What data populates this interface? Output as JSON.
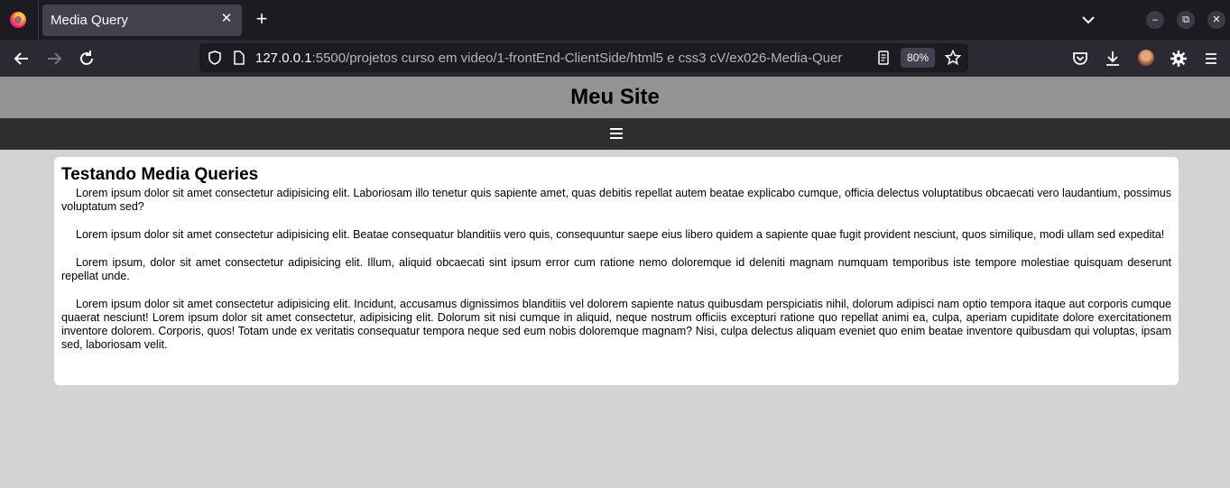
{
  "browser": {
    "tab_title": "Media Query",
    "tab_close": "✕",
    "new_tab": "+",
    "url_host": "127.0.0.1",
    "url_rest": ":5500/projetos curso em video/1-frontEnd-ClientSide/html5 e css3 cV/ex026-Media-Quer",
    "zoom": "80%",
    "window_controls": {
      "minimize": "–",
      "restore": "⧉",
      "close": "✕"
    },
    "icons": [
      "firefox-logo",
      "back-icon",
      "forward-icon",
      "reload-icon",
      "shield-icon",
      "page-icon",
      "reader-view-icon",
      "bookmark-star-icon",
      "pocket-icon",
      "download-icon",
      "avatar",
      "extension-gear-icon",
      "hamburger-menu-icon",
      "tab-list-chevron-icon"
    ]
  },
  "site": {
    "title": "Meu Site",
    "nav_icon": "hamburger-menu-icon",
    "article": {
      "heading": "Testando Media Queries",
      "paragraphs": [
        "Lorem ipsum dolor sit amet consectetur adipisicing elit. Laboriosam illo tenetur quis sapiente amet, quas debitis repellat autem beatae explicabo cumque, officia delectus voluptatibus obcaecati vero laudantium, possimus voluptatum sed?",
        "Lorem ipsum dolor sit amet consectetur adipisicing elit. Beatae consequatur blanditiis vero quis, consequuntur saepe eius libero quidem a sapiente quae fugit provident nesciunt, quos similique, modi ullam sed expedita!",
        "Lorem ipsum, dolor sit amet consectetur adipisicing elit. Illum, aliquid obcaecati sint ipsum error cum ratione nemo doloremque id deleniti magnam numquam temporibus iste tempore molestiae quisquam deserunt repellat unde.",
        "Lorem ipsum dolor sit amet consectetur adipisicing elit. Incidunt, accusamus dignissimos blanditiis vel dolorem sapiente natus quibusdam perspiciatis nihil, dolorum adipisci nam optio tempora itaque aut corporis cumque quaerat nesciunt! Lorem ipsum dolor sit amet consectetur, adipisicing elit. Dolorum sit nisi cumque in aliquid, neque nostrum officiis excepturi ratione quo repellat animi ea, culpa, aperiam cupiditate dolore exercitationem inventore dolorem. Corporis, quos! Totam unde ex veritatis consequatur tempora neque sed eum nobis doloremque magnam? Nisi, culpa delectus aliquam eveniet quo enim beatae inventore quibusdam qui voluptas, ipsam sed, laboriosam velit."
      ]
    }
  },
  "colors": {
    "page_bg": "#d3d3d3",
    "header_bg": "#949494",
    "nav_bg": "#2e2e2e",
    "card_bg": "#ffffff",
    "chrome_dark": "#1c1b22",
    "chrome_toolbar": "#2b2a33"
  }
}
